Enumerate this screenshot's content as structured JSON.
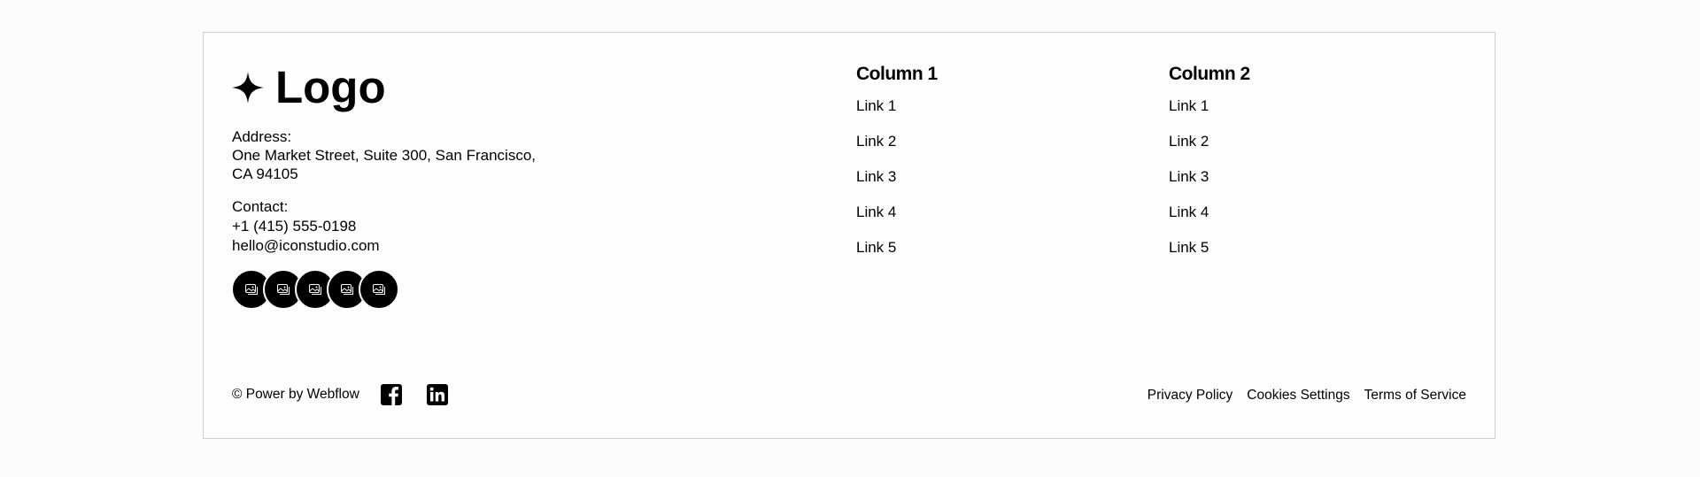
{
  "brand": {
    "logo_text": "Logo",
    "icon": "four-point-star-icon"
  },
  "address": {
    "label": "Address:",
    "line1": "One Market Street, Suite 300, San Francisco,",
    "line2": "CA 94105"
  },
  "contact": {
    "label": "Contact:",
    "phone": "+1 (415) 555-0198",
    "email": "hello@iconstudio.com"
  },
  "socials": {
    "icons": [
      "image-icon",
      "image-icon",
      "image-icon",
      "image-icon",
      "image-icon"
    ]
  },
  "columns": [
    {
      "title": "Column 1",
      "links": [
        "Link 1",
        "Link 2",
        "Link 3",
        "Link 4",
        "Link 5"
      ]
    },
    {
      "title": "Column 2",
      "links": [
        "Link 1",
        "Link 2",
        "Link 3",
        "Link 4",
        "Link 5"
      ]
    }
  ],
  "bottom": {
    "copyright": "© Power by Webflow",
    "icons": [
      "facebook-icon",
      "linkedin-icon"
    ],
    "legal_links": [
      "Privacy Policy",
      "Cookies Settings",
      "Terms of Service"
    ]
  },
  "colors": {
    "text": "#000000",
    "background": "#fcfcfc",
    "border": "#cfcfcf"
  }
}
